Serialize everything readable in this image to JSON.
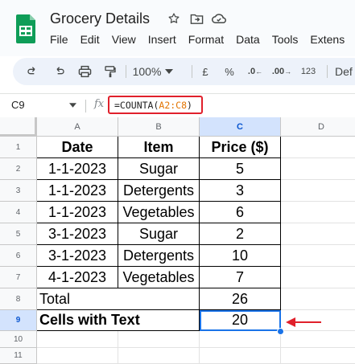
{
  "app": {
    "doc_title": "Grocery Details",
    "menu": [
      "File",
      "Edit",
      "View",
      "Insert",
      "Format",
      "Data",
      "Tools",
      "Extens"
    ]
  },
  "toolbar": {
    "zoom": "100%",
    "currency": "£",
    "percent": "%",
    "decrease_decimal": ".0",
    "increase_decimal": ".00",
    "number_format": "123",
    "font": "Def"
  },
  "formula_bar": {
    "cell_ref": "C9",
    "fx": "fx",
    "formula_prefix": "=COUNTA(",
    "formula_range": "A2:C8",
    "formula_suffix": ")"
  },
  "columns": [
    "A",
    "B",
    "C",
    "D"
  ],
  "rows": [
    "1",
    "2",
    "3",
    "4",
    "5",
    "6",
    "7",
    "8",
    "9",
    "10",
    "11"
  ],
  "table": {
    "headers": [
      "Date",
      "Item",
      "Price ($)"
    ],
    "rows": [
      [
        "1-1-2023",
        "Sugar",
        "5"
      ],
      [
        "1-1-2023",
        "Detergents",
        "3"
      ],
      [
        "1-1-2023",
        "Vegetables",
        "6"
      ],
      [
        "3-1-2023",
        "Sugar",
        "2"
      ],
      [
        "3-1-2023",
        "Detergents",
        "10"
      ],
      [
        "4-1-2023",
        "Vegetables",
        "7"
      ]
    ],
    "total_label": "Total",
    "total_value": "26",
    "count_label": "Cells with Text",
    "count_value": "20"
  },
  "colors": {
    "accent": "#1a73e8",
    "highlight_red": "#e0202b",
    "range_orange": "#e37400",
    "logo_green": "#0f9d58"
  }
}
